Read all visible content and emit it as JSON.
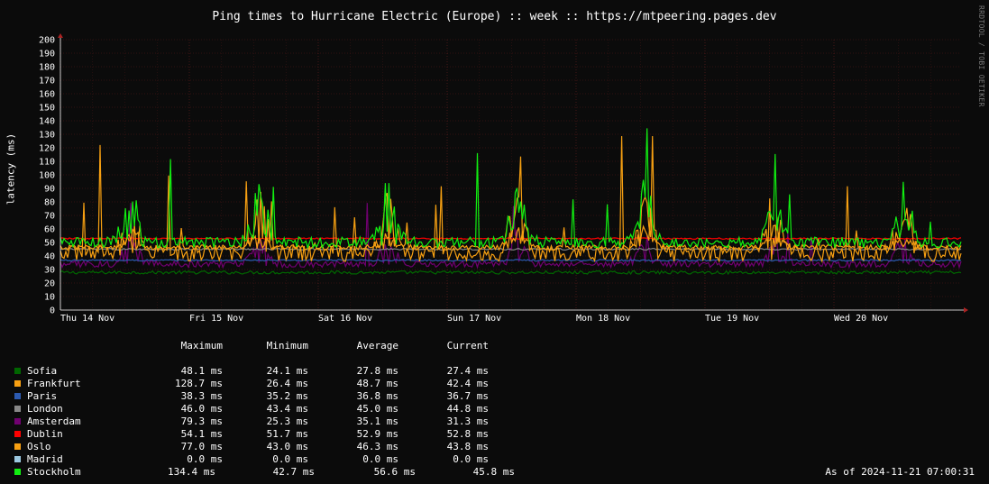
{
  "title": "Ping times to Hurricane Electric (Europe) :: week :: https://mtpeering.pages.dev",
  "side_label": "RRDTOOL / TOBI OETIKER",
  "as_of": "As of 2024-11-21 07:00:31",
  "legend_headers": [
    "Maximum",
    "Minimum",
    "Average",
    "Current"
  ],
  "legend": [
    {
      "name": "Sofia",
      "color": "#006600",
      "max": "48.1 ms",
      "min": "24.1 ms",
      "avg": "27.8 ms",
      "cur": "27.4 ms"
    },
    {
      "name": "Frankfurt",
      "color": "#f7a012",
      "max": "128.7 ms",
      "min": "26.4 ms",
      "avg": "48.7 ms",
      "cur": "42.4 ms"
    },
    {
      "name": "Paris",
      "color": "#2c5ab0",
      "max": "38.3 ms",
      "min": "35.2 ms",
      "avg": "36.8 ms",
      "cur": "36.7 ms"
    },
    {
      "name": "London",
      "color": "#888888",
      "max": "46.0 ms",
      "min": "43.4 ms",
      "avg": "45.0 ms",
      "cur": "44.8 ms"
    },
    {
      "name": "Amsterdam",
      "color": "#700070",
      "max": "79.3 ms",
      "min": "25.3 ms",
      "avg": "35.1 ms",
      "cur": "31.3 ms"
    },
    {
      "name": "Dublin",
      "color": "#ff0000",
      "max": "54.1 ms",
      "min": "51.7 ms",
      "avg": "52.9 ms",
      "cur": "52.8 ms"
    },
    {
      "name": "Oslo",
      "color": "#f7a012",
      "max": "77.0 ms",
      "min": "43.0 ms",
      "avg": "46.3 ms",
      "cur": "43.8 ms"
    },
    {
      "name": "Madrid",
      "color": "#9cc8e0",
      "max": "0.0 ms",
      "min": "0.0 ms",
      "avg": "0.0 ms",
      "cur": "0.0 ms"
    },
    {
      "name": "Stockholm",
      "color": "#11ee11",
      "max": "134.4 ms",
      "min": "42.7 ms",
      "avg": "56.6 ms",
      "cur": "45.8 ms"
    }
  ],
  "chart_data": {
    "type": "line",
    "title": "Ping times to Hurricane Electric (Europe) :: week :: https://mtpeering.pages.dev",
    "ylabel": "latency (ms)",
    "xlabel": "",
    "ylim": [
      0,
      200
    ],
    "y_ticks": [
      0,
      10,
      20,
      30,
      40,
      50,
      60,
      70,
      80,
      90,
      100,
      110,
      120,
      130,
      140,
      150,
      160,
      170,
      180,
      190,
      200
    ],
    "x_day_labels": [
      "Thu 14 Nov",
      "Fri 15 Nov",
      "Sat 16 Nov",
      "Sun 17 Nov",
      "Mon 18 Nov",
      "Tue 19 Nov",
      "Wed 20 Nov"
    ],
    "grid": true,
    "series": [
      {
        "name": "Sofia",
        "color": "#006600",
        "base": 27.8,
        "noise": 1.2,
        "spikes": 0,
        "max": 48.1
      },
      {
        "name": "Frankfurt",
        "color": "#f7a012",
        "base": 42.0,
        "noise": 6.0,
        "spikes": 9,
        "max": 128.7
      },
      {
        "name": "Paris",
        "color": "#2c5ab0",
        "base": 36.8,
        "noise": 0.6,
        "spikes": 0,
        "max": 38.3
      },
      {
        "name": "London",
        "color": "#888888",
        "base": 45.0,
        "noise": 0.6,
        "spikes": 0,
        "max": 46.0
      },
      {
        "name": "Amsterdam",
        "color": "#700070",
        "base": 34.0,
        "noise": 2.5,
        "spikes": 2,
        "max": 79.3
      },
      {
        "name": "Dublin",
        "color": "#ff0000",
        "base": 52.9,
        "noise": 0.5,
        "spikes": 0,
        "max": 54.1
      },
      {
        "name": "Oslo",
        "color": "#f7a012",
        "base": 46.3,
        "noise": 2.0,
        "spikes": 3,
        "max": 77.0
      },
      {
        "name": "Madrid",
        "color": "#9cc8e0",
        "base": 0.0,
        "noise": 0.0,
        "spikes": 0,
        "max": 0.0
      },
      {
        "name": "Stockholm",
        "color": "#11ee11",
        "base": 50.0,
        "noise": 4.0,
        "spikes": 12,
        "max": 134.4
      }
    ]
  }
}
